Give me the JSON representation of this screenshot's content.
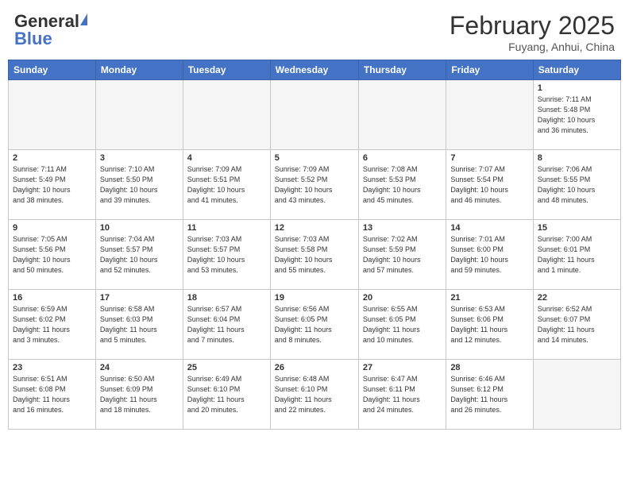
{
  "header": {
    "logo_general": "General",
    "logo_blue": "Blue",
    "month_title": "February 2025",
    "location": "Fuyang, Anhui, China"
  },
  "days_of_week": [
    "Sunday",
    "Monday",
    "Tuesday",
    "Wednesday",
    "Thursday",
    "Friday",
    "Saturday"
  ],
  "weeks": [
    [
      {
        "num": "",
        "info": ""
      },
      {
        "num": "",
        "info": ""
      },
      {
        "num": "",
        "info": ""
      },
      {
        "num": "",
        "info": ""
      },
      {
        "num": "",
        "info": ""
      },
      {
        "num": "",
        "info": ""
      },
      {
        "num": "1",
        "info": "Sunrise: 7:11 AM\nSunset: 5:48 PM\nDaylight: 10 hours\nand 36 minutes."
      }
    ],
    [
      {
        "num": "2",
        "info": "Sunrise: 7:11 AM\nSunset: 5:49 PM\nDaylight: 10 hours\nand 38 minutes."
      },
      {
        "num": "3",
        "info": "Sunrise: 7:10 AM\nSunset: 5:50 PM\nDaylight: 10 hours\nand 39 minutes."
      },
      {
        "num": "4",
        "info": "Sunrise: 7:09 AM\nSunset: 5:51 PM\nDaylight: 10 hours\nand 41 minutes."
      },
      {
        "num": "5",
        "info": "Sunrise: 7:09 AM\nSunset: 5:52 PM\nDaylight: 10 hours\nand 43 minutes."
      },
      {
        "num": "6",
        "info": "Sunrise: 7:08 AM\nSunset: 5:53 PM\nDaylight: 10 hours\nand 45 minutes."
      },
      {
        "num": "7",
        "info": "Sunrise: 7:07 AM\nSunset: 5:54 PM\nDaylight: 10 hours\nand 46 minutes."
      },
      {
        "num": "8",
        "info": "Sunrise: 7:06 AM\nSunset: 5:55 PM\nDaylight: 10 hours\nand 48 minutes."
      }
    ],
    [
      {
        "num": "9",
        "info": "Sunrise: 7:05 AM\nSunset: 5:56 PM\nDaylight: 10 hours\nand 50 minutes."
      },
      {
        "num": "10",
        "info": "Sunrise: 7:04 AM\nSunset: 5:57 PM\nDaylight: 10 hours\nand 52 minutes."
      },
      {
        "num": "11",
        "info": "Sunrise: 7:03 AM\nSunset: 5:57 PM\nDaylight: 10 hours\nand 53 minutes."
      },
      {
        "num": "12",
        "info": "Sunrise: 7:03 AM\nSunset: 5:58 PM\nDaylight: 10 hours\nand 55 minutes."
      },
      {
        "num": "13",
        "info": "Sunrise: 7:02 AM\nSunset: 5:59 PM\nDaylight: 10 hours\nand 57 minutes."
      },
      {
        "num": "14",
        "info": "Sunrise: 7:01 AM\nSunset: 6:00 PM\nDaylight: 10 hours\nand 59 minutes."
      },
      {
        "num": "15",
        "info": "Sunrise: 7:00 AM\nSunset: 6:01 PM\nDaylight: 11 hours\nand 1 minute."
      }
    ],
    [
      {
        "num": "16",
        "info": "Sunrise: 6:59 AM\nSunset: 6:02 PM\nDaylight: 11 hours\nand 3 minutes."
      },
      {
        "num": "17",
        "info": "Sunrise: 6:58 AM\nSunset: 6:03 PM\nDaylight: 11 hours\nand 5 minutes."
      },
      {
        "num": "18",
        "info": "Sunrise: 6:57 AM\nSunset: 6:04 PM\nDaylight: 11 hours\nand 7 minutes."
      },
      {
        "num": "19",
        "info": "Sunrise: 6:56 AM\nSunset: 6:05 PM\nDaylight: 11 hours\nand 8 minutes."
      },
      {
        "num": "20",
        "info": "Sunrise: 6:55 AM\nSunset: 6:05 PM\nDaylight: 11 hours\nand 10 minutes."
      },
      {
        "num": "21",
        "info": "Sunrise: 6:53 AM\nSunset: 6:06 PM\nDaylight: 11 hours\nand 12 minutes."
      },
      {
        "num": "22",
        "info": "Sunrise: 6:52 AM\nSunset: 6:07 PM\nDaylight: 11 hours\nand 14 minutes."
      }
    ],
    [
      {
        "num": "23",
        "info": "Sunrise: 6:51 AM\nSunset: 6:08 PM\nDaylight: 11 hours\nand 16 minutes."
      },
      {
        "num": "24",
        "info": "Sunrise: 6:50 AM\nSunset: 6:09 PM\nDaylight: 11 hours\nand 18 minutes."
      },
      {
        "num": "25",
        "info": "Sunrise: 6:49 AM\nSunset: 6:10 PM\nDaylight: 11 hours\nand 20 minutes."
      },
      {
        "num": "26",
        "info": "Sunrise: 6:48 AM\nSunset: 6:10 PM\nDaylight: 11 hours\nand 22 minutes."
      },
      {
        "num": "27",
        "info": "Sunrise: 6:47 AM\nSunset: 6:11 PM\nDaylight: 11 hours\nand 24 minutes."
      },
      {
        "num": "28",
        "info": "Sunrise: 6:46 AM\nSunset: 6:12 PM\nDaylight: 11 hours\nand 26 minutes."
      },
      {
        "num": "",
        "info": ""
      }
    ]
  ]
}
